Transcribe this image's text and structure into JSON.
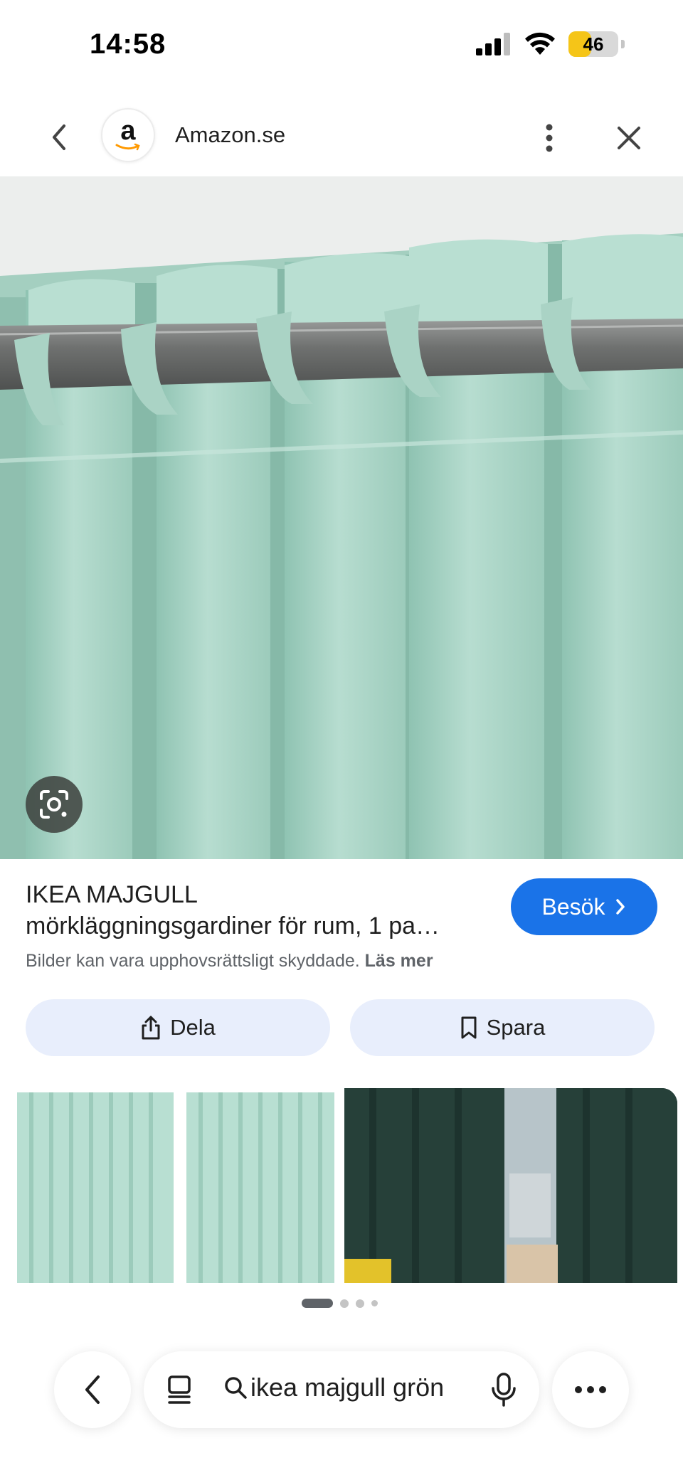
{
  "status_bar": {
    "time": "14:58",
    "battery": "46",
    "battery_level": 0.46
  },
  "header": {
    "logo_letter": "a",
    "site_name": "Amazon.se"
  },
  "product": {
    "title_line1": "IKEA MAJGULL",
    "title_line2": "mörkläggningsgardiner för rum, 1 pa…",
    "visit_label": "Besök",
    "copyright_text": "Bilder kan vara upphovsrättsligt skyddade.",
    "read_more": "Läs mer"
  },
  "actions": {
    "share_label": "Dela",
    "save_label": "Spara"
  },
  "search": {
    "query": "ikea majgull grön"
  },
  "colors": {
    "accent": "#1a73e8",
    "pill_bg": "#e8eefc",
    "curtain": "#a9d2c4",
    "battery": "#f5c518"
  },
  "icons": {
    "back": "chevron-left-icon",
    "more": "more-vert-icon",
    "close": "close-icon",
    "lens": "google-lens-icon",
    "share": "share-icon",
    "save": "bookmark-icon",
    "search": "search-icon",
    "mic": "mic-icon",
    "tabs": "tabs-icon"
  }
}
